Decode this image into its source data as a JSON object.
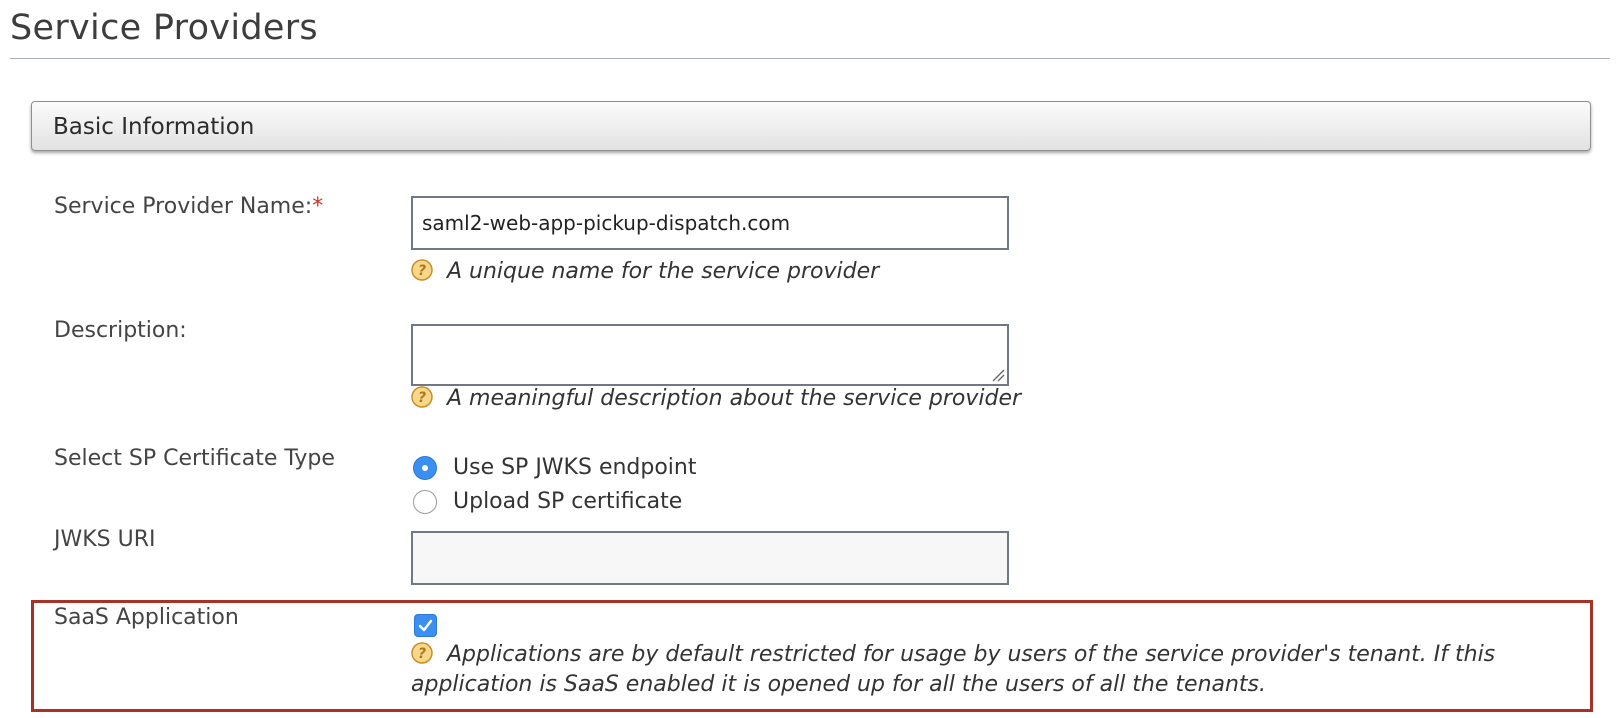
{
  "page": {
    "title": "Service Providers"
  },
  "section": {
    "title": "Basic Information"
  },
  "form": {
    "name": {
      "label": "Service Provider Name:",
      "required_marker": "*",
      "value": "saml2-web-app-pickup-dispatch.com",
      "hint": "A unique name for the service provider"
    },
    "description": {
      "label": "Description:",
      "value": "",
      "hint": "A meaningful description about the service provider"
    },
    "cert_type": {
      "label": "Select SP Certificate Type",
      "options": [
        {
          "label": "Use SP JWKS endpoint",
          "selected": true
        },
        {
          "label": "Upload SP certificate",
          "selected": false
        }
      ]
    },
    "jwks": {
      "label": "JWKS URI",
      "value": ""
    },
    "saas": {
      "label": "SaaS Application",
      "checked": true,
      "hint": "Applications are by default restricted for usage by users of the service provider's tenant. If this application is SaaS enabled it is opened up for all the users of all the tenants."
    }
  },
  "colors": {
    "accent": "#3b8ff0",
    "required": "#d0312d",
    "highlight_border": "#a93226",
    "help_icon": "#d9a441"
  },
  "icons": {
    "help": "question-circle-icon",
    "check": "checkmark-icon",
    "resize": "resize-grip-icon"
  }
}
